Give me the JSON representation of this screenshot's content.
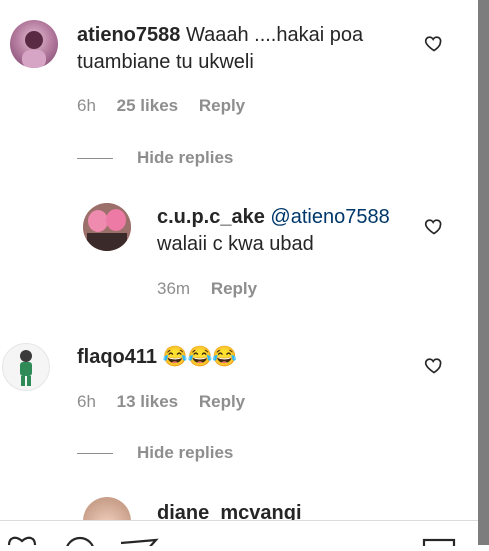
{
  "comments": [
    {
      "username": "atieno7588",
      "text": "Waaah ....hakai poa tuambiane tu ukweli",
      "time": "6h",
      "likes": "25 likes",
      "reply": "Reply"
    },
    {
      "username": "c.u.p.c_ake",
      "mention": "@atieno7588",
      "text": "walaii c kwa ubad",
      "time": "36m",
      "reply": "Reply"
    },
    {
      "username": "flaqo411",
      "text": "😂😂😂",
      "time": "6h",
      "likes": "13 likes",
      "reply": "Reply"
    },
    {
      "username": "diane_mcvangi"
    }
  ],
  "hide_replies": "Hide replies",
  "colors": {
    "mention": "#00376b",
    "muted": "#8e8e8e",
    "text": "#262626"
  }
}
